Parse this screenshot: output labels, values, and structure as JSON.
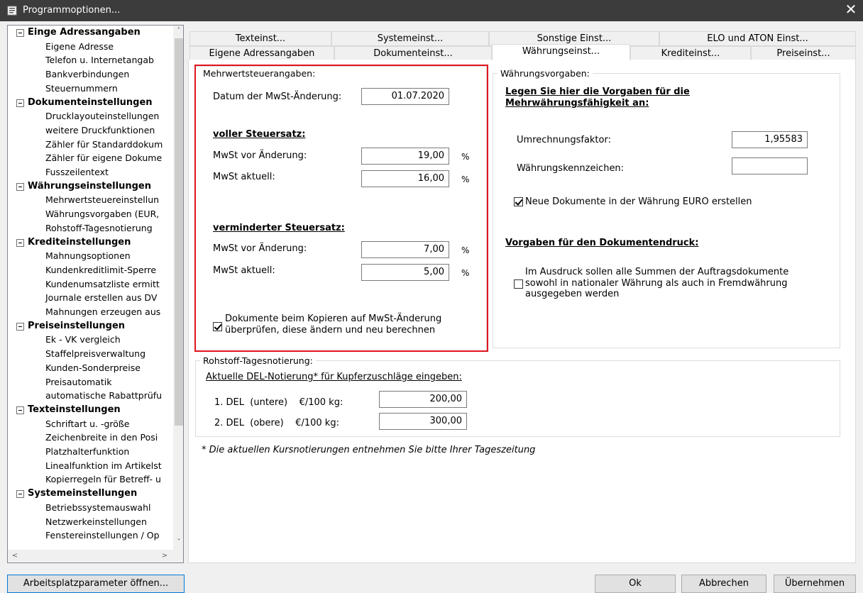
{
  "window": {
    "title": "Programmoptionen...",
    "close": "✕"
  },
  "tree": {
    "groups": [
      {
        "label": "Einge Adressangaben",
        "items": [
          "Eigene Adresse",
          "Telefon u. Internetangab",
          "Bankverbindungen",
          "Steuernummern"
        ]
      },
      {
        "label": "Dokumenteinstellungen",
        "items": [
          "Drucklayouteinstellungen",
          "weitere Druckfunktionen",
          "Zähler für Standarddokum",
          "Zähler für eigene Dokume",
          "Fusszeilentext"
        ]
      },
      {
        "label": "Währungseinstellungen",
        "items": [
          "Mehrwertsteuereinstellun",
          "Währungsvorgaben (EUR,",
          "Rohstoff-Tagesnotierung"
        ]
      },
      {
        "label": "Krediteinstellungen",
        "items": [
          "Mahnungsoptionen",
          "Kundenkreditlimit-Sperre",
          "Kundenumsatzliste ermitt",
          "Journale erstellen aus DV",
          "Mahnungen erzeugen aus"
        ]
      },
      {
        "label": "Preiseinstellungen",
        "items": [
          "Ek - VK vergleich",
          "Staffelpreisverwaltung",
          "Kunden-Sonderpreise",
          "Preisautomatik",
          "automatische Rabattprüfu"
        ]
      },
      {
        "label": "Texteinstellungen",
        "items": [
          "Schriftart u. -größe",
          "Zeichenbreite in den Posi",
          "Platzhalterfunktion",
          "Linealfunktion im Artikelst",
          "Kopierregeln für Betreff- u"
        ]
      },
      {
        "label": "Systemeinstellungen",
        "items": [
          "Betriebssystemauswahl",
          "Netzwerkeinstellungen",
          "Fenstereinstellungen / Op"
        ]
      }
    ],
    "scroll": {
      "up": "˄",
      "down": "˅",
      "left": "<",
      "right": ">"
    }
  },
  "tabs_row1": [
    "Texteinst...",
    "Systemeinst...",
    "Sonstige Einst...",
    "ELO und ATON Einst..."
  ],
  "tabs_row2": [
    "Eigene Adressangaben",
    "Dokumenteinst...",
    "Währungseinst...",
    "Krediteinst...",
    "Preiseinst..."
  ],
  "mwst": {
    "legend": "Mehrwertsteuerangaben:",
    "date_label": "Datum der MwSt-Änderung:",
    "date_value": "01.07.2020",
    "full_heading": "voller Steuersatz:",
    "before_label": "MwSt vor Änderung:",
    "current_label": "MwSt aktuell:",
    "full_before": "19,00",
    "full_current": "16,00",
    "reduced_heading": "verminderter Steuersatz:",
    "reduced_before": "7,00",
    "reduced_current": "5,00",
    "percent": "%",
    "copy_check_line1": "Dokumente beim Kopieren auf MwSt-Änderung",
    "copy_check_line2": "überprüfen, diese ändern und neu berechnen",
    "copy_checked": true,
    "highlight_color": "#e0141e"
  },
  "currency": {
    "legend": "Währungsvorgaben:",
    "heading_line1": "Legen Sie hier die Vorgaben für die",
    "heading_line2": "Mehrwährungsfähigkeit an:",
    "factor_label": "Umrechnungsfaktor:",
    "factor_value": "1,95583",
    "symbol_label": "Währungskennzeichen:",
    "symbol_value": "",
    "euro_check": "Neue Dokumente in der Währung EURO erstellen",
    "euro_checked": true,
    "print_heading": "Vorgaben für den Dokumentendruck:",
    "print_line1": "Im Ausdruck sollen alle Summen der Auftragsdokumente",
    "print_line2": "sowohl in nationaler Währung als auch in Fremdwährung",
    "print_line3": "ausgegeben werden",
    "print_checked": false
  },
  "rohstoff": {
    "legend": "Rohstoff-Tagesnotierung:",
    "heading": "Aktuelle DEL-Notierung* für Kupferzuschläge eingeben:",
    "row1_label": "1. DEL  (untere)    €/100 kg:",
    "row1_value": "200,00",
    "row2_label": "2. DEL  (obere)    €/100 kg:",
    "row2_value": "300,00"
  },
  "footnote": "* Die aktuellen Kursnotierungen entnehmen Sie bitte Ihrer Tageszeitung",
  "buttons": {
    "workplace": "Arbeitsplatzparameter öffnen...",
    "ok": "Ok",
    "cancel": "Abbrechen",
    "apply": "Übernehmen"
  }
}
